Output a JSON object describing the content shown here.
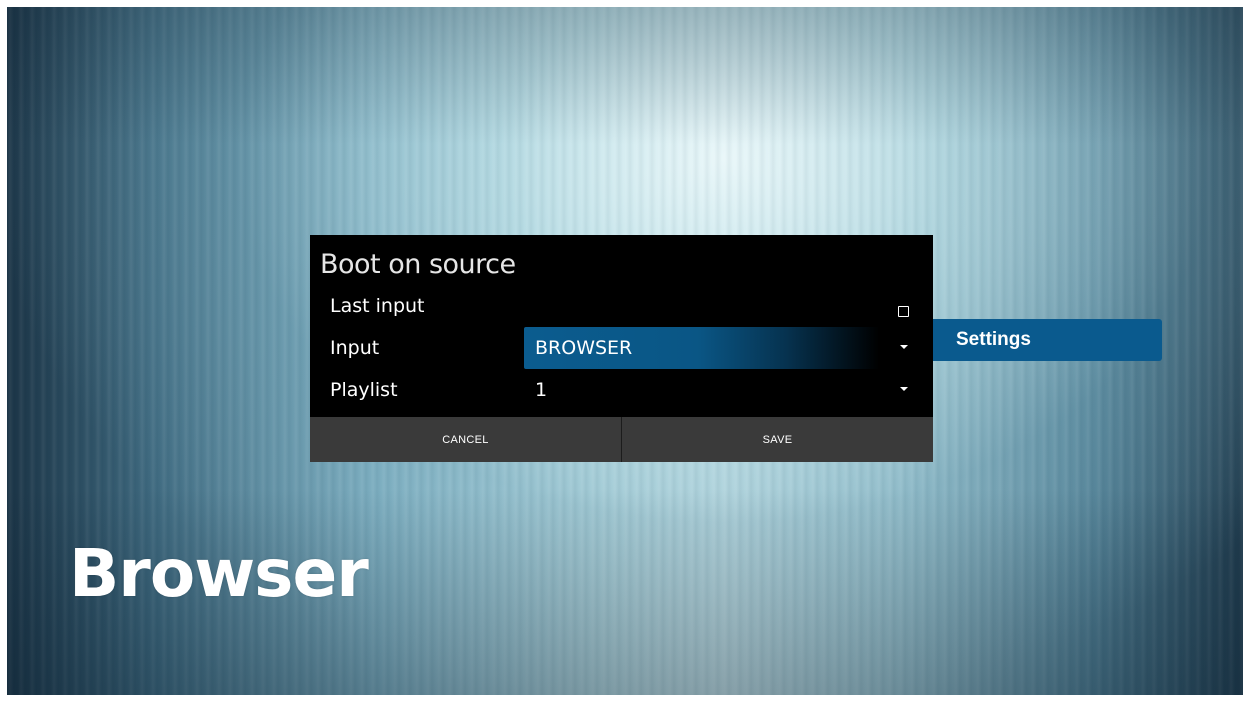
{
  "dialog": {
    "title": "Boot on source",
    "rows": {
      "last_input_label": "Last input",
      "last_input_checked": false,
      "input_label": "Input",
      "input_value": "BROWSER",
      "playlist_label": "Playlist",
      "playlist_value": "1"
    },
    "buttons": {
      "cancel": "CANCEL",
      "save": "SAVE"
    }
  },
  "side_tab": {
    "label": "Settings"
  },
  "screen": {
    "title": "Browser"
  },
  "colors": {
    "accent": "#0a5a8e",
    "dialog_bg": "#000000",
    "button_bar": "#3a3a3a"
  },
  "icons": {
    "checkbox": "checkbox-unchecked-icon",
    "dropdown": "caret-down-icon"
  }
}
